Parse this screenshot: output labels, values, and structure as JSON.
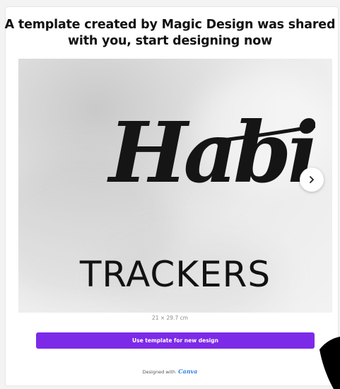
{
  "header": {
    "line1": "A template created by Magic Design was shared",
    "line2": "with you, start designing now"
  },
  "preview": {
    "script_word": "Habit",
    "block_word": "TRACKERS",
    "next_icon": "chevron-right-icon",
    "dimensions": "21 × 29.7 cm"
  },
  "actions": {
    "use_template_label": "Use template for new design"
  },
  "footer": {
    "designed_with": "Designed with",
    "brand": "Canva"
  },
  "colors": {
    "accent": "#7d2ae8",
    "brand_text": "#2f7fe0"
  }
}
